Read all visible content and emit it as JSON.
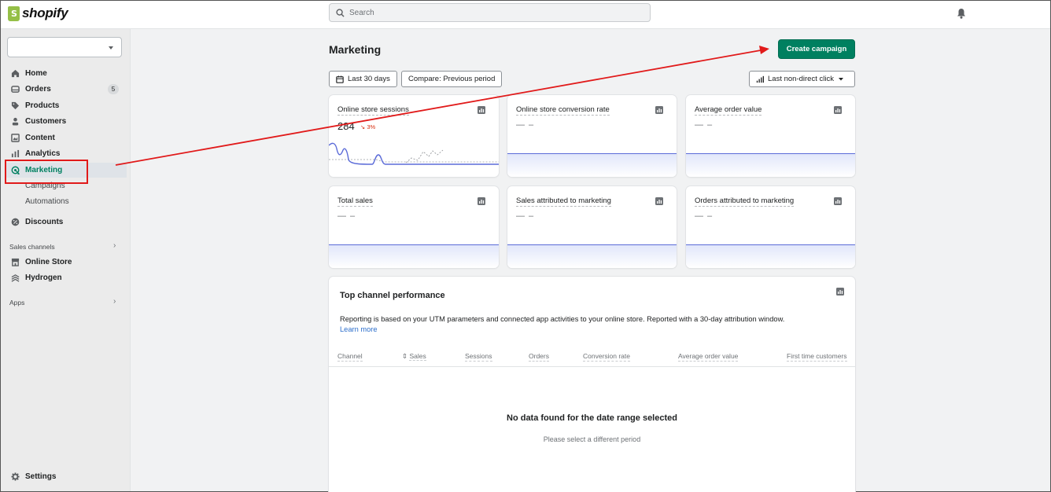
{
  "topbar": {
    "logo_text": "shopify",
    "search_placeholder": "Search"
  },
  "sidebar": {
    "store_selector_value": "",
    "items": [
      {
        "label": "Home",
        "icon": "home-icon"
      },
      {
        "label": "Orders",
        "icon": "orders-icon",
        "badge": "5"
      },
      {
        "label": "Products",
        "icon": "tag-icon"
      },
      {
        "label": "Customers",
        "icon": "person-icon"
      },
      {
        "label": "Content",
        "icon": "content-icon"
      },
      {
        "label": "Analytics",
        "icon": "bar-chart-icon"
      },
      {
        "label": "Marketing",
        "icon": "target-icon",
        "active": true
      },
      {
        "label": "Campaigns"
      },
      {
        "label": "Automations"
      },
      {
        "label": "Discounts",
        "icon": "discount-icon"
      }
    ],
    "sales_channels_label": "Sales channels",
    "channels": [
      {
        "label": "Online Store",
        "icon": "store-icon"
      },
      {
        "label": "Hydrogen",
        "icon": "hydrogen-icon"
      }
    ],
    "apps_label": "Apps",
    "settings_label": "Settings"
  },
  "page": {
    "title": "Marketing",
    "create_button": "Create campaign",
    "date_range": "Last 30 days",
    "compare": "Compare: Previous period",
    "attribution": "Last non-direct click"
  },
  "metrics": [
    {
      "title": "Online store sessions",
      "value": "284",
      "change": "3%",
      "change_direction": "down"
    },
    {
      "title": "Online store conversion rate",
      "value": "— –"
    },
    {
      "title": "Average order value",
      "value": "— –"
    },
    {
      "title": "Total sales",
      "value": "— –"
    },
    {
      "title": "Sales attributed to marketing",
      "value": "— –"
    },
    {
      "title": "Orders attributed to marketing",
      "value": "— –"
    }
  ],
  "top_channel": {
    "title": "Top channel performance",
    "description": "Reporting is based on your UTM parameters and connected app activities to your online store. Reported with a 30-day attribution window.",
    "learn_more": "Learn more",
    "columns": [
      "Channel",
      "Sales",
      "Sessions",
      "Orders",
      "Conversion rate",
      "Average order value",
      "First time customers"
    ],
    "empty_title": "No data found for the date range selected",
    "empty_subtitle": "Please select a different period"
  },
  "colors": {
    "brand_green": "#008060",
    "annotation_red": "#e11a1a",
    "chart_line": "#5b6bd8"
  }
}
